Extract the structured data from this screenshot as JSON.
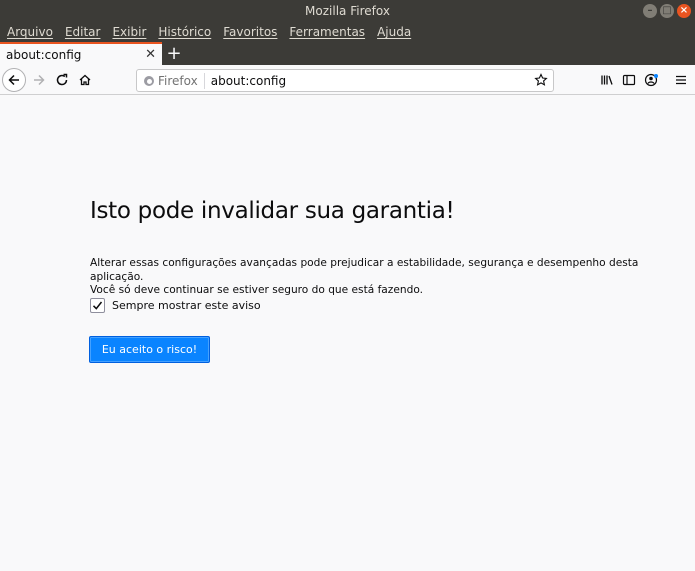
{
  "window": {
    "title": "Mozilla Firefox",
    "controls": [
      "minimize",
      "maximize",
      "close"
    ]
  },
  "menubar": {
    "items": [
      "Arquivo",
      "Editar",
      "Exibir",
      "Histórico",
      "Favoritos",
      "Ferramentas",
      "Ajuda"
    ]
  },
  "tabs": [
    {
      "label": "about:config",
      "active": true
    }
  ],
  "newtab_label": "+",
  "navbar": {
    "identity_label": "Firefox",
    "url": "about:config"
  },
  "page": {
    "title": "Isto pode invalidar sua garantia!",
    "description_line1": "Alterar essas configurações avançadas pode prejudicar a estabilidade, segurança e desempenho desta aplicação.",
    "description_line2": "Você só deve continuar se estiver seguro do que está fazendo.",
    "checkbox_label": "Sempre mostrar este aviso",
    "checkbox_checked": true,
    "accept_button": "Eu aceito o risco!"
  },
  "colors": {
    "titlebar": "#3c3b37",
    "accent": "#0a84ff",
    "tab_highlight": "#e95420"
  }
}
